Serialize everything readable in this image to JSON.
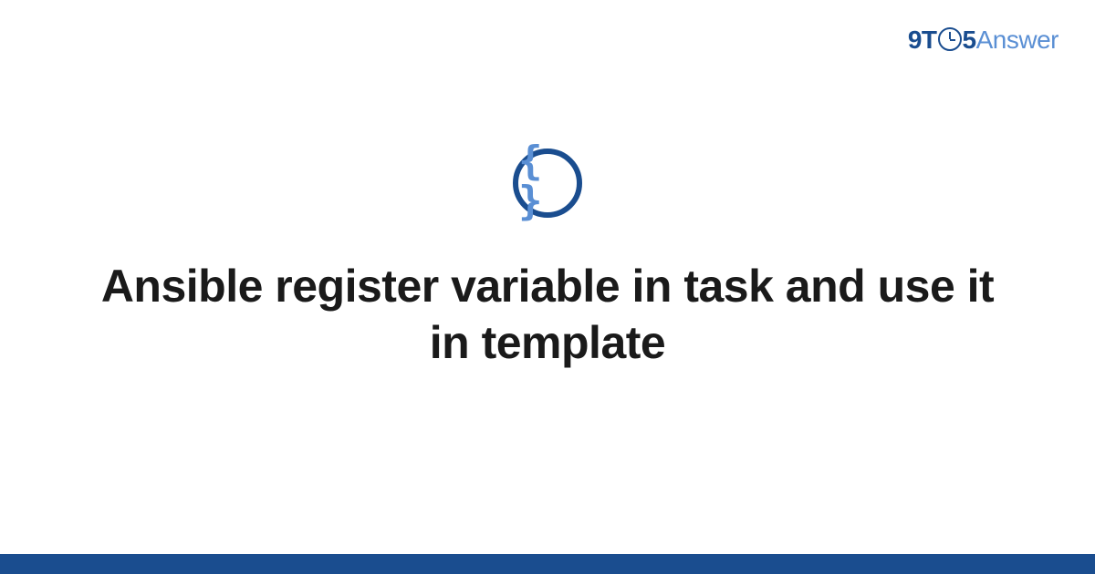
{
  "logo": {
    "part1": "9T",
    "part2": "5",
    "part3": "Answer"
  },
  "category_icon": {
    "name": "braces-icon",
    "glyph": "{ }"
  },
  "title": "Ansible register variable in task and use it in template",
  "colors": {
    "brand_primary": "#1a4d8f",
    "brand_secondary": "#5a8fd4",
    "footer": "#1a4d8f"
  }
}
